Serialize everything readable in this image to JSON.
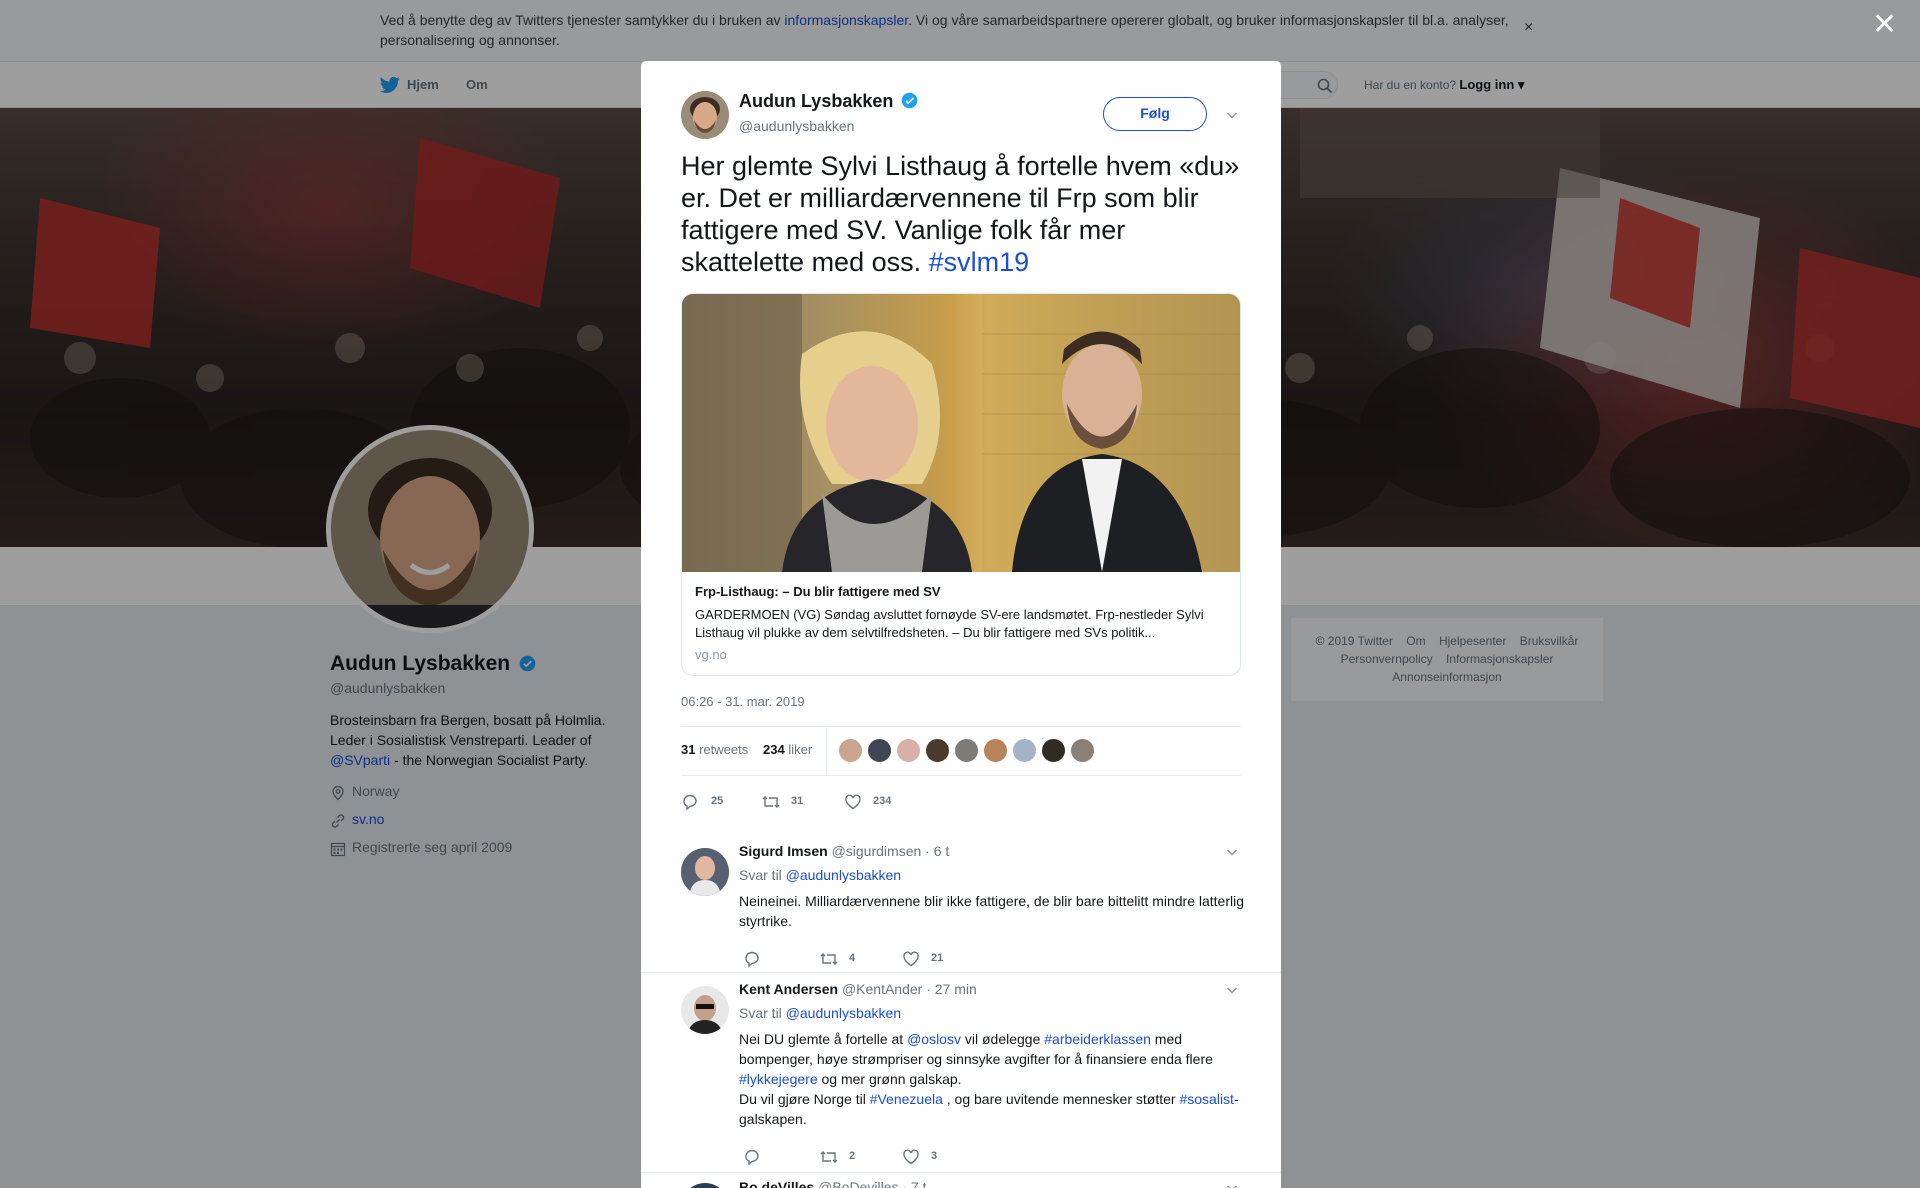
{
  "cookie": {
    "text_before": "Ved å benytte deg av Twitters tjenester samtykker du i bruken av ",
    "link": "informasjonskapsler",
    "text_after": ". Vi og våre samarbeidspartnere opererer globalt, og bruker informasjonskapsler til bl.a. analyser, personalisering og annonser.",
    "close": "×"
  },
  "nav": {
    "home": "Hjem",
    "about": "Om",
    "account_question": "Har du en konto?",
    "login": "Logg inn"
  },
  "profile": {
    "name": "Audun Lysbakken",
    "handle": "@audunlysbakken",
    "bio_line1": "Brosteinsbarn fra Bergen, bosatt på Holmlia.",
    "bio_line2": "Leder i Sosialistisk Venstreparti. Leader of",
    "bio_link": "@SVparti",
    "bio_line3": " - the Norwegian Socialist Party.",
    "location": "Norway",
    "website": "sv.no",
    "joined": "Registrerte seg april 2009"
  },
  "footer": {
    "items": [
      "© 2019 Twitter",
      "Om",
      "Hjelpesenter",
      "Bruksvilkår",
      "Personvernpolicy",
      "Informasjonskapsler",
      "Annonseinformasjon"
    ]
  },
  "overlay_close": "✕",
  "tweet": {
    "author_name": "Audun Lysbakken",
    "author_handle": "@audunlysbakken",
    "follow_label": "Følg",
    "text": "Her glemte Sylvi Listhaug å fortelle hvem «du» er. Det er milliardærvennene til Frp som blir fattigere med SV. Vanlige folk får mer skattelette med oss. ",
    "hashtag": "#svlm19",
    "card": {
      "title": "Frp-Listhaug: – Du blir fattigere med SV",
      "description": "GARDERMOEN (VG) Søndag avsluttet fornøyde SV-ere landsmøtet. Frp-nestleder Sylvi Listhaug vil plukke av dem selvtilfredsheten. – Du blir fattigere med SVs politik...",
      "domain": "vg.no"
    },
    "timestamp": "06:26 - 31. mar. 2019",
    "retweets_count": "31",
    "retweets_label": "retweets",
    "likes_count": "234",
    "likes_label": "liker",
    "actions": {
      "replies": "25",
      "retweets": "31",
      "likes": "234"
    }
  },
  "replies": [
    {
      "name": "Sigurd Imsen",
      "handle": "@sigurdimsen",
      "time": "· 6 t",
      "to_label": "Svar til",
      "to_handle": "@audunlysbakken",
      "text": "Neineinei. Milliardærvennene blir ikke fattigere, de blir bare bittelitt mindre latterlig styrtrike.",
      "retweets": "4",
      "likes": "21"
    },
    {
      "name": "Kent Andersen",
      "handle": "@KentAnder",
      "time": "· 27 min",
      "to_label": "Svar til",
      "to_handle": "@audunlysbakken",
      "text_p1": "Nei DU glemte å fortelle at ",
      "link1": "@oslosv",
      "text_p2": " vil ødelegge ",
      "link2": "#arbeiderklassen",
      "text_p3": " med bompenger, høye strømpriser og sinnsyke avgifter for å finansiere enda flere ",
      "link3": "#lykkejegere",
      "text_p4": " og mer grønn galskap.",
      "text_p5": "Du vil gjøre Norge til ",
      "link4": "#Venezuela",
      "text_p6": " , og bare uvitende mennesker støtter ",
      "link5": "#sosalist",
      "text_p7": "-galskapen.",
      "retweets": "2",
      "likes": "3"
    },
    {
      "name": "Bo deVilles",
      "handle": "@BoDevilles",
      "time": "· 7 t"
    }
  ],
  "colors": {
    "link": "#1b4ed8",
    "verified": "#1da1f2",
    "muted": "#66757f"
  }
}
